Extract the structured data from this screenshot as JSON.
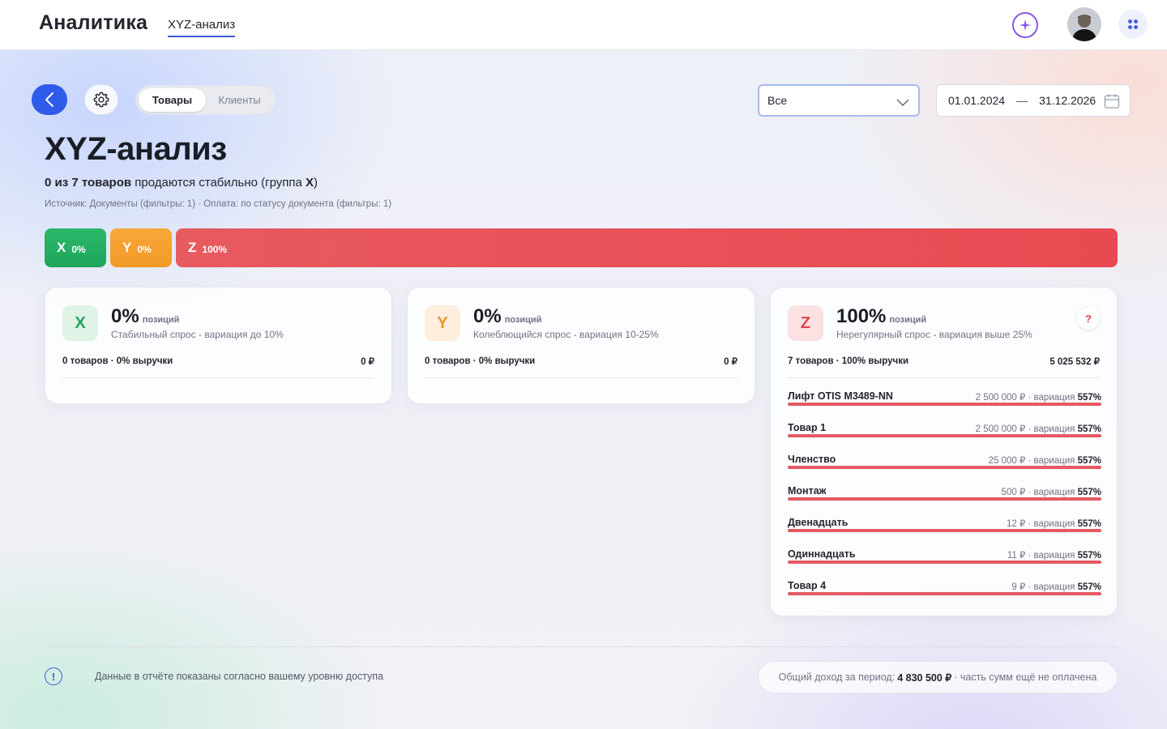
{
  "header": {
    "app_title": "Аналитика",
    "active_tab": "XYZ-анализ"
  },
  "toolbar": {
    "tabs": [
      {
        "label": "Товары",
        "active": true
      },
      {
        "label": "Клиенты",
        "active": false
      }
    ],
    "filter_select": {
      "value": "Все"
    },
    "date_range": {
      "from": "01.01.2024",
      "separator": "—",
      "to": "31.12.2026"
    }
  },
  "page": {
    "title": "XYZ-анализ",
    "summary": {
      "count_text": "0 из 7 товаров",
      "middle_text": " продаются стабильно (группа ",
      "group": "X",
      "end_text": ")"
    },
    "source": "Источник: Документы (фильтры: 1) · Оплата: по статусу документа (фильтры: 1)"
  },
  "distribution": [
    {
      "letter": "X",
      "pct": "0%",
      "share": 0,
      "color": "#22ac60"
    },
    {
      "letter": "Y",
      "pct": "0%",
      "share": 0,
      "color": "#f4a02e"
    },
    {
      "letter": "Z",
      "pct": "100%",
      "share": 100,
      "color": "#e8525a"
    }
  ],
  "cards": {
    "x": {
      "letter": "X",
      "pct": "0%",
      "pos_label": "позиций",
      "desc": "Стабильный спрос - вариация до 10%",
      "meta": "0 товаров · 0% выручки",
      "total": "0 ₽"
    },
    "y": {
      "letter": "Y",
      "pct": "0%",
      "pos_label": "позиций",
      "desc": "Колеблющийся спрос - вариация 10-25%",
      "meta": "0 товаров · 0% выручки",
      "total": "0 ₽"
    },
    "z": {
      "letter": "Z",
      "pct": "100%",
      "pos_label": "позиций",
      "desc": "Нерегулярный спрос - вариация выше 25%",
      "meta": "7 товаров · 100% выручки",
      "total": "5 025 532 ₽",
      "help": "?",
      "items": [
        {
          "name": "Лифт OTIS M3489-NN",
          "amount": "2 500 000 ₽ · вариация ",
          "variation": "557%",
          "fill": 1.0
        },
        {
          "name": "Товар 1",
          "amount": "2 500 000 ₽ · вариация ",
          "variation": "557%",
          "fill": 1.0
        },
        {
          "name": "Членство",
          "amount": "25 000 ₽ · вариация ",
          "variation": "557%",
          "fill": 1.0
        },
        {
          "name": "Монтаж",
          "amount": "500 ₽ · вариация ",
          "variation": "557%",
          "fill": 1.0
        },
        {
          "name": "Двенадцать",
          "amount": "12 ₽ · вариация ",
          "variation": "557%",
          "fill": 1.0
        },
        {
          "name": "Одиннадцать",
          "amount": "11 ₽ · вариация ",
          "variation": "557%",
          "fill": 1.0
        },
        {
          "name": "Товар 4",
          "amount": "9 ₽ · вариация ",
          "variation": "557%",
          "fill": 1.0
        }
      ]
    }
  },
  "footer": {
    "note": "Данные в отчёте показаны согласно вашему уровню доступа",
    "income_label": "Общий доход за период:",
    "income_value": "4 830 500 ₽",
    "income_suffix": "· часть сумм ещё не оплачена"
  },
  "colors": {
    "accent": "#2f5bea",
    "x": "#20a55b",
    "y": "#f0962a",
    "z": "#e0464f"
  }
}
